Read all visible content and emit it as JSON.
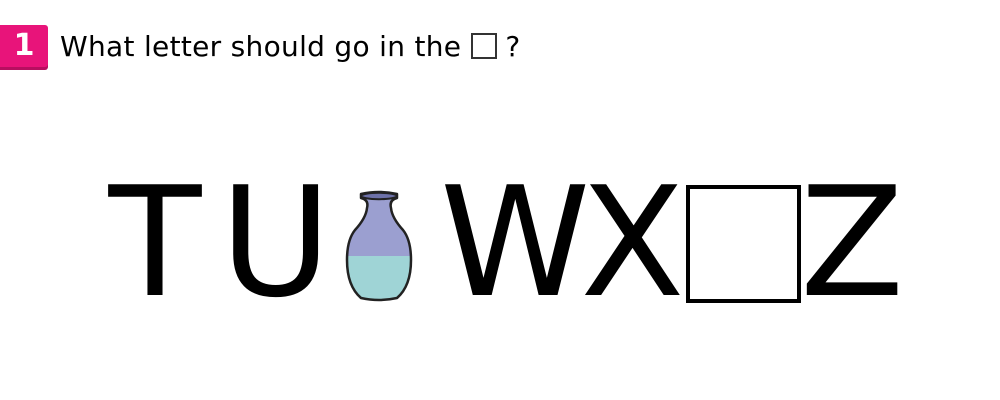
{
  "question": {
    "number": "1",
    "text": "What letter should go in the",
    "suffix": "?"
  },
  "sequence": {
    "letters": [
      "T",
      "U",
      "W",
      "X",
      "Z"
    ]
  },
  "colors": {
    "badge": "#e8147a",
    "vase_top": "#9b9fd0",
    "vase_bottom": "#9fd4d6"
  }
}
